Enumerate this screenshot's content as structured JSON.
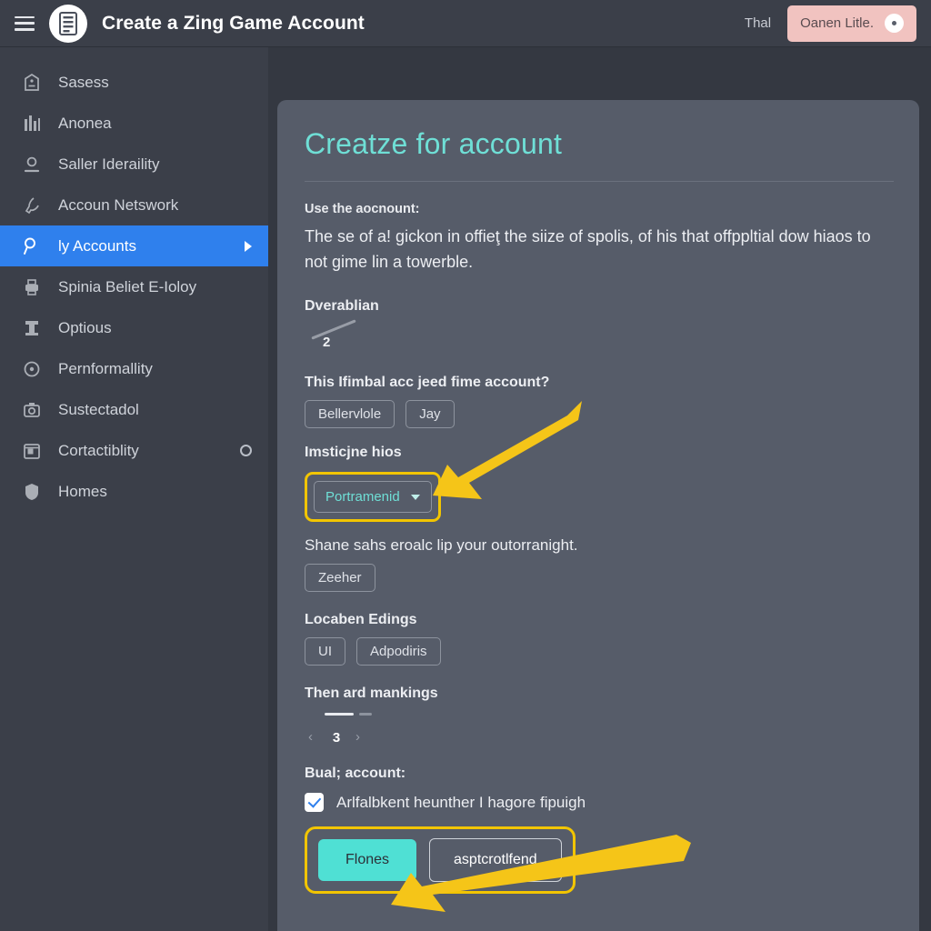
{
  "topbar": {
    "menu_icon": "hamburger-icon",
    "logo_icon": "document-logo-icon",
    "title": "Create a Zing Game Account",
    "link_label": "Thal",
    "user_name": "Oanen Litle.",
    "avatar_icon": "user-avatar-icon"
  },
  "sidebar": {
    "items": [
      {
        "label": "Sasess",
        "icon": "home-badge-icon",
        "active": false,
        "trailing": "none"
      },
      {
        "label": "Anonea",
        "icon": "chart-bars-icon",
        "active": false,
        "trailing": "none"
      },
      {
        "label": "Saller Ideraility",
        "icon": "person-icon",
        "active": false,
        "trailing": "none"
      },
      {
        "label": "Accoun Netswork",
        "icon": "key-icon",
        "active": false,
        "trailing": "none"
      },
      {
        "label": "ly Accounts",
        "icon": "search-key-icon",
        "active": true,
        "trailing": "caret"
      },
      {
        "label": "Spinia Beliet E-Ioloy",
        "icon": "printer-icon",
        "active": false,
        "trailing": "none"
      },
      {
        "label": "Optious",
        "icon": "tower-icon",
        "active": false,
        "trailing": "none"
      },
      {
        "label": "Pernformallity",
        "icon": "clock-icon",
        "active": false,
        "trailing": "none"
      },
      {
        "label": "Sustectadol",
        "icon": "camera-icon",
        "active": false,
        "trailing": "none"
      },
      {
        "label": "Cortactiblity",
        "icon": "calendar-icon",
        "active": false,
        "trailing": "dot"
      },
      {
        "label": "Homes",
        "icon": "shield-icon",
        "active": false,
        "trailing": "none"
      }
    ]
  },
  "main": {
    "title": "Creatze for account",
    "lead": "Use the aocnount:",
    "body": "The se of a! gickon in offieţ the siize of spolis, of his that offppltial dow hiaos to not gime lin a towerble.",
    "sections": {
      "overablian": {
        "label": "Dverablian",
        "slider_value": "2"
      },
      "limbal": {
        "label": "This Ifimbal acc jeed fime account?",
        "chips": [
          "Bellervlole",
          "Jay"
        ]
      },
      "instincts": {
        "label": "Imsticjne hios",
        "dropdown_value": "Portramenid",
        "highlighted": true
      },
      "share": {
        "label": "Shane sahs eroalc lip your outorranight.",
        "chips": [
          "Zeeher"
        ]
      },
      "locaben": {
        "label": "Locaben Edings",
        "chips": [
          "UI",
          "Adpodiris"
        ]
      },
      "mankings": {
        "label": "Then ard mankings",
        "stepper_value": "3"
      },
      "buai": {
        "label": "Bual; account:",
        "checkbox_label": "Arlfalbkent heunther I hagore fipuigh",
        "checkbox_checked": true
      }
    },
    "actions": {
      "primary_label": "Flones",
      "secondary_label": "asptcrotlfend",
      "highlighted": true
    }
  },
  "annotations": {
    "arrow_color": "#f5c518",
    "highlight_color": "#f2c500",
    "arrow_count": 2
  },
  "colors": {
    "accent_teal": "#4fe0d4",
    "active_blue": "#2f80ed",
    "panel_bg": "#565c69",
    "sidebar_bg": "#3b3f49",
    "page_bg": "#343841",
    "user_chip": "#f1c3c0"
  }
}
